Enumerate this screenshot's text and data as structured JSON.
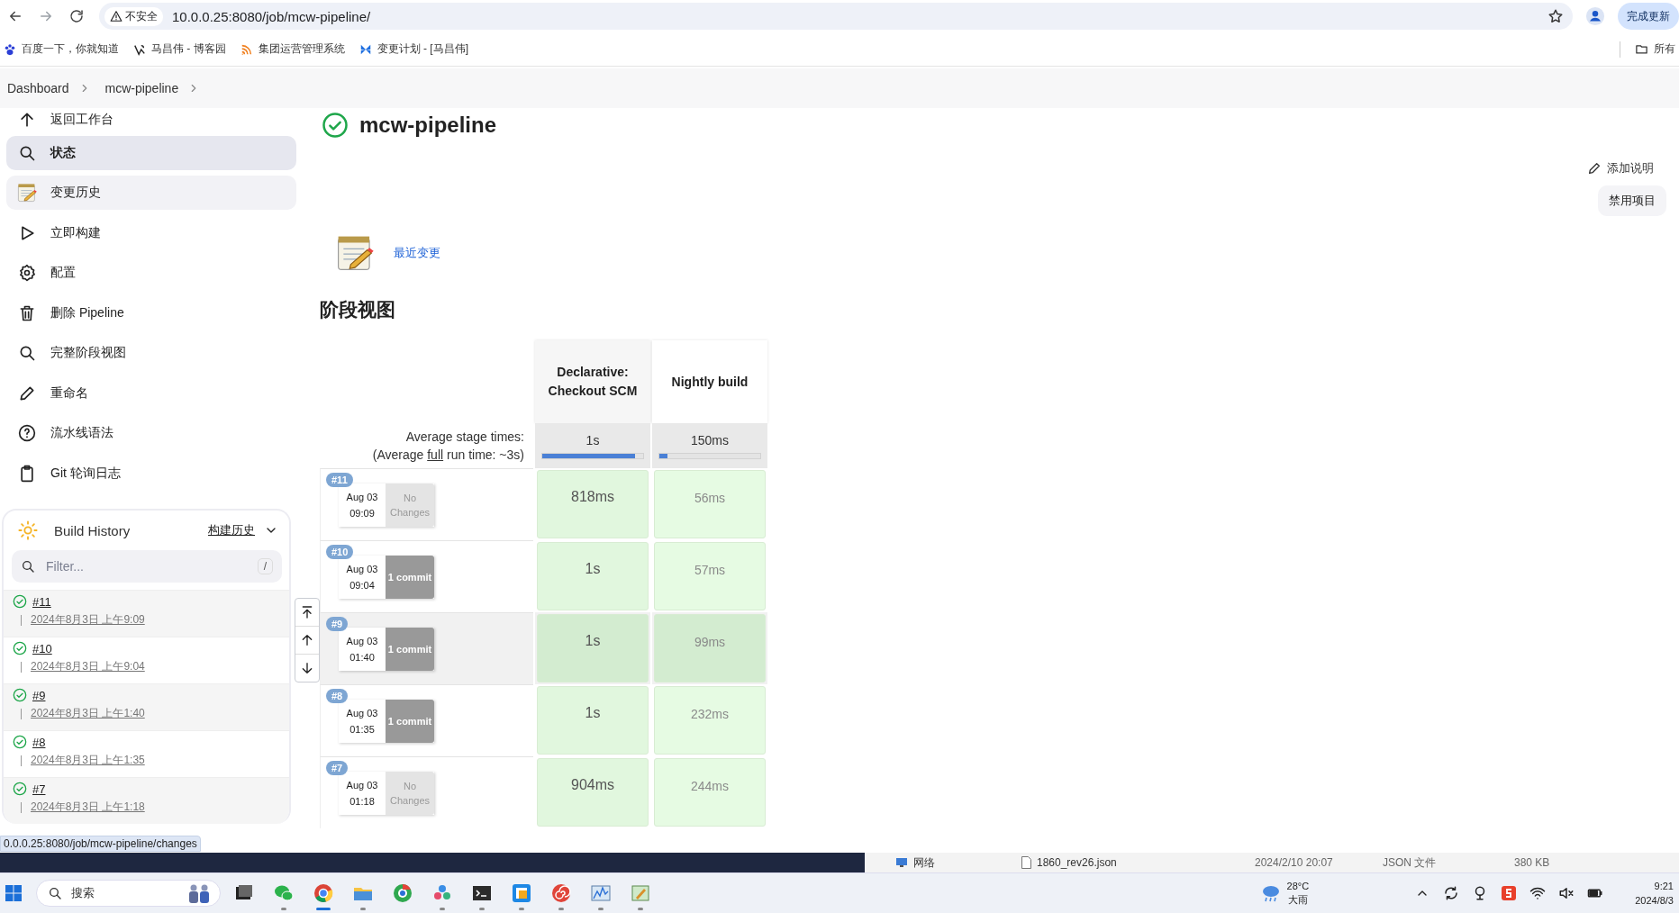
{
  "browser": {
    "security_label": "不安全",
    "url": "10.0.0.25:8080/job/mcw-pipeline/",
    "update_button": "完成更新"
  },
  "bookmarks": [
    {
      "label": "百度一下，你就知道"
    },
    {
      "label": "马昌伟 - 博客园"
    },
    {
      "label": "集团运营管理系统"
    },
    {
      "label": "变更计划 - [马昌伟]"
    }
  ],
  "bookmarks_folder": "所有",
  "breadcrumb": [
    {
      "label": "Dashboard"
    },
    {
      "label": "mcw-pipeline"
    }
  ],
  "sidebar": {
    "items": [
      {
        "label": "返回工作台",
        "selected": false,
        "hovered": false
      },
      {
        "label": "状态",
        "selected": true,
        "hovered": false
      },
      {
        "label": "变更历史",
        "selected": false,
        "hovered": true
      },
      {
        "label": "立即构建",
        "selected": false,
        "hovered": false
      },
      {
        "label": "配置",
        "selected": false,
        "hovered": false
      },
      {
        "label": "删除 Pipeline",
        "selected": false,
        "hovered": false
      },
      {
        "label": "完整阶段视图",
        "selected": false,
        "hovered": false
      },
      {
        "label": "重命名",
        "selected": false,
        "hovered": false
      },
      {
        "label": "流水线语法",
        "selected": false,
        "hovered": false
      },
      {
        "label": "Git 轮询日志",
        "selected": false,
        "hovered": false
      }
    ]
  },
  "build_history": {
    "title": "Build History",
    "link": "构建历史",
    "filter_placeholder": "Filter...",
    "shortcut": "/",
    "builds": [
      {
        "number": "#11",
        "time": "2024年8月3日 上午9:09"
      },
      {
        "number": "#10",
        "time": "2024年8月3日 上午9:04"
      },
      {
        "number": "#9",
        "time": "2024年8月3日 上午1:40"
      },
      {
        "number": "#8",
        "time": "2024年8月3日 上午1:35"
      },
      {
        "number": "#7",
        "time": "2024年8月3日 上午1:18"
      }
    ]
  },
  "job": {
    "title": "mcw-pipeline",
    "add_description": "添加说明",
    "disable_button": "禁用项目",
    "recent_changes": "最近变更"
  },
  "stage_view": {
    "heading": "阶段视图",
    "avg_label": "Average stage times:",
    "avg_full_prefix": "(Average ",
    "avg_full_link": "full",
    "avg_full_suffix": " run time: ~3s)",
    "stages": [
      {
        "name": "Declarative: Checkout SCM",
        "avg": "1s",
        "level": 0.92
      },
      {
        "name": "Nightly build",
        "avg": "150ms",
        "level": 0.08
      }
    ],
    "runs": [
      {
        "number": "#11",
        "date": "Aug 03",
        "time": "09:09",
        "changes": "No Changes",
        "kind": "none",
        "highlighted": false,
        "durations": [
          "818ms",
          "56ms"
        ]
      },
      {
        "number": "#10",
        "date": "Aug 03",
        "time": "09:04",
        "changes": "1 commit",
        "kind": "commits",
        "highlighted": false,
        "durations": [
          "1s",
          "57ms"
        ]
      },
      {
        "number": "#9",
        "date": "Aug 03",
        "time": "01:40",
        "changes": "1 commit",
        "kind": "commits",
        "highlighted": true,
        "durations": [
          "1s",
          "99ms"
        ]
      },
      {
        "number": "#8",
        "date": "Aug 03",
        "time": "01:35",
        "changes": "1 commit",
        "kind": "commits",
        "highlighted": false,
        "durations": [
          "1s",
          "232ms"
        ]
      },
      {
        "number": "#7",
        "date": "Aug 03",
        "time": "01:18",
        "changes": "No Changes",
        "kind": "none",
        "highlighted": false,
        "durations": [
          "904ms",
          "244ms"
        ]
      }
    ]
  },
  "status_tooltip": "0.0.0.25:8080/job/mcw-pipeline/changes",
  "explorer_fragment": {
    "folder": "网络",
    "file": "1860_rev26.json",
    "modified": "2024/2/10 20:07",
    "type": "JSON 文件",
    "size": "380 KB"
  },
  "taskbar": {
    "search_placeholder": "搜索",
    "weather_temp": "28°C",
    "weather_desc": "大雨",
    "time": "9:21",
    "date": "2024/8/3",
    "apps": [
      {
        "running": false,
        "active": false
      },
      {
        "running": true,
        "active": false
      },
      {
        "running": true,
        "active": true
      },
      {
        "running": true,
        "active": false
      },
      {
        "running": false,
        "active": false
      },
      {
        "running": true,
        "active": false
      },
      {
        "running": true,
        "active": false
      },
      {
        "running": true,
        "active": false
      },
      {
        "running": true,
        "active": false
      },
      {
        "running": true,
        "active": false
      },
      {
        "running": true,
        "active": false
      }
    ]
  }
}
